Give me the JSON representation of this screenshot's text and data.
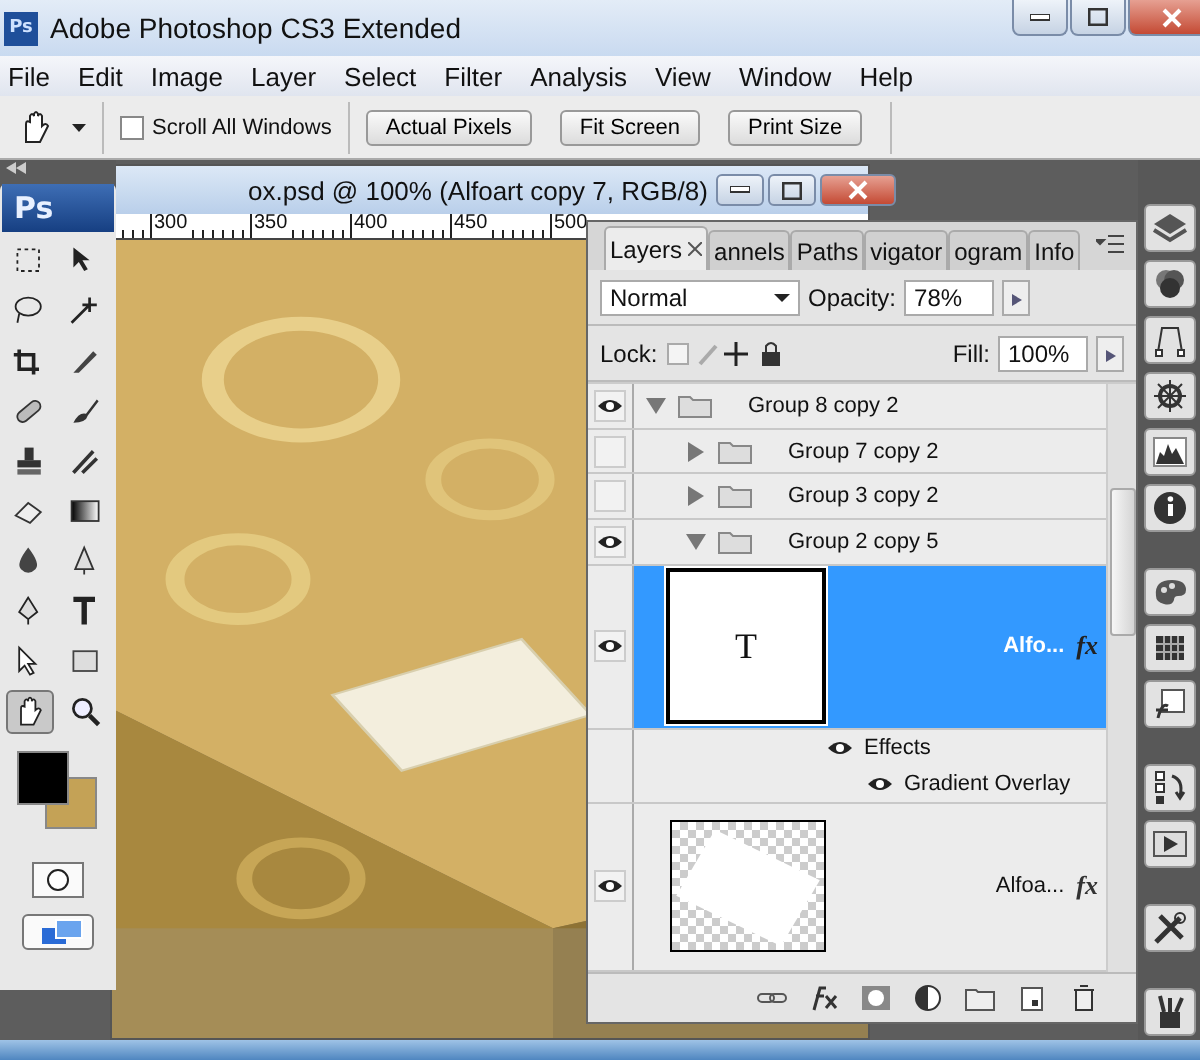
{
  "window": {
    "app_icon": "Ps",
    "title": "Adobe Photoshop CS3 Extended"
  },
  "menu": [
    "File",
    "Edit",
    "Image",
    "Layer",
    "Select",
    "Filter",
    "Analysis",
    "View",
    "Window",
    "Help"
  ],
  "options_bar": {
    "scroll_all": {
      "label": "Scroll All Windows",
      "checked": false
    },
    "buttons": [
      "Actual Pixels",
      "Fit Screen",
      "Print Size"
    ]
  },
  "document": {
    "title": "ox.psd @ 100% (Alfoart copy 7, RGB/8)",
    "ruler": [
      "300",
      "350",
      "400",
      "450",
      "500"
    ],
    "kind": "picture"
  },
  "toolbox": {
    "logo": "Ps",
    "tools": [
      {
        "selected": false
      },
      {
        "selected": false
      },
      {
        "selected": false
      },
      {
        "selected": false
      },
      {
        "selected": false
      },
      {
        "selected": false
      },
      {
        "selected": false
      },
      {
        "selected": false
      },
      {
        "selected": false
      },
      {
        "selected": false
      },
      {
        "selected": false
      },
      {
        "selected": false
      },
      {
        "selected": false
      },
      {
        "selected": false
      },
      {
        "selected": false
      },
      {
        "selected": false
      },
      {
        "selected": false
      },
      {
        "selected": false
      },
      {
        "selected": true
      },
      {
        "selected": false
      }
    ],
    "swatches": [
      {
        "color": "#000000"
      },
      {
        "color": "#c4a256"
      }
    ]
  },
  "layers_panel": {
    "tabs": [
      {
        "label": "Layers",
        "selected": true
      },
      {
        "label": "annels",
        "selected": false
      },
      {
        "label": "Paths",
        "selected": false
      },
      {
        "label": "vigator",
        "selected": false
      },
      {
        "label": "ogram",
        "selected": false
      },
      {
        "label": "Info",
        "selected": false
      }
    ],
    "blend_mode": "Normal",
    "opacity_label": "Opacity:",
    "opacity": "78%",
    "lock_label": "Lock:",
    "fill_label": "Fill:",
    "fill": "100%",
    "layers": [
      {
        "kind": "group",
        "name": "Group 8 copy 2",
        "visible": true,
        "expanded": true,
        "selected": false,
        "children": [
          {
            "kind": "group",
            "name": "Group 7 copy 2",
            "visible": false,
            "expanded": false,
            "selected": false
          },
          {
            "kind": "group",
            "name": "Group 3 copy 2",
            "visible": false,
            "expanded": false,
            "selected": false
          },
          {
            "kind": "group",
            "name": "Group 2 copy 5",
            "visible": true,
            "expanded": true,
            "selected": false,
            "children": [
              {
                "kind": "text",
                "name": "Alfo...",
                "thumb": "T",
                "visible": true,
                "selected": true,
                "fx": "fx",
                "effects": {
                  "label": "Effects",
                  "items": [
                    "Gradient Overlay"
                  ]
                }
              },
              {
                "kind": "raster",
                "name": "Alfoa...",
                "visible": true,
                "selected": false,
                "fx": "fx"
              }
            ]
          }
        ]
      }
    ]
  }
}
